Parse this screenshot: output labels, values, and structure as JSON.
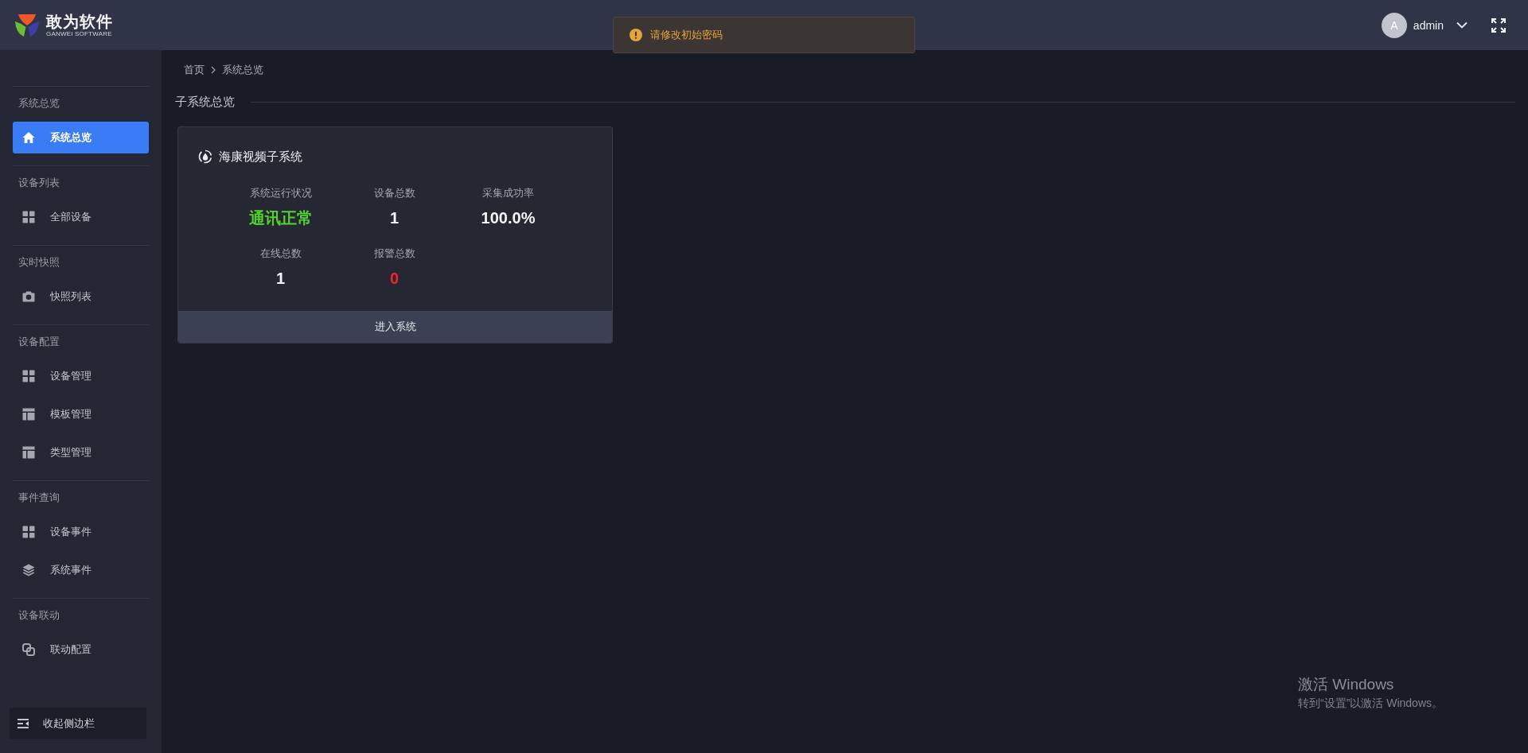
{
  "header": {
    "logo": {
      "title": "敢为软件",
      "subtitle": "GANWEI SOFTWARE"
    },
    "user": {
      "avatar": "A",
      "name": "admin"
    }
  },
  "toast": {
    "message": "请修改初始密码"
  },
  "sidebar": {
    "groups": [
      {
        "label": "系统总览",
        "items": [
          {
            "label": "系统总览",
            "selected": true
          }
        ]
      },
      {
        "label": "设备列表",
        "items": [
          {
            "label": "全部设备",
            "selected": false
          }
        ]
      },
      {
        "label": "实时快照",
        "items": [
          {
            "label": "快照列表",
            "selected": false
          }
        ]
      },
      {
        "label": "设备配置",
        "items": [
          {
            "label": "设备管理",
            "selected": false
          },
          {
            "label": "模板管理",
            "selected": false
          },
          {
            "label": "类型管理",
            "selected": false
          }
        ]
      },
      {
        "label": "事件查询",
        "items": [
          {
            "label": "设备事件",
            "selected": false
          },
          {
            "label": "系统事件",
            "selected": false
          }
        ]
      },
      {
        "label": "设备联动",
        "items": [
          {
            "label": "联动配置",
            "selected": false
          }
        ]
      }
    ],
    "collapse_button": "收起侧边栏"
  },
  "breadcrumb": [
    "首页",
    "系统总览"
  ],
  "section_title": "子系统总览",
  "subsystems": [
    {
      "name": "海康视频子系统",
      "stats": [
        {
          "label": "系统运行状况",
          "value": "通讯正常",
          "color": "#52d22c"
        },
        {
          "label": "设备总数",
          "value": "1",
          "color": "#f2f4f7"
        },
        {
          "label": "采集成功率",
          "value": "100.0%",
          "color": "#f2f4f7"
        },
        {
          "label": "在线总数",
          "value": "1",
          "color": "#f2f4f7"
        },
        {
          "label": "报警总数",
          "value": "0",
          "color": "#ee2530"
        }
      ],
      "action": "进入系统"
    }
  ],
  "windows_activation": {
    "title": "激活 Windows",
    "message": "转到“设置”以激活 Windows。"
  }
}
